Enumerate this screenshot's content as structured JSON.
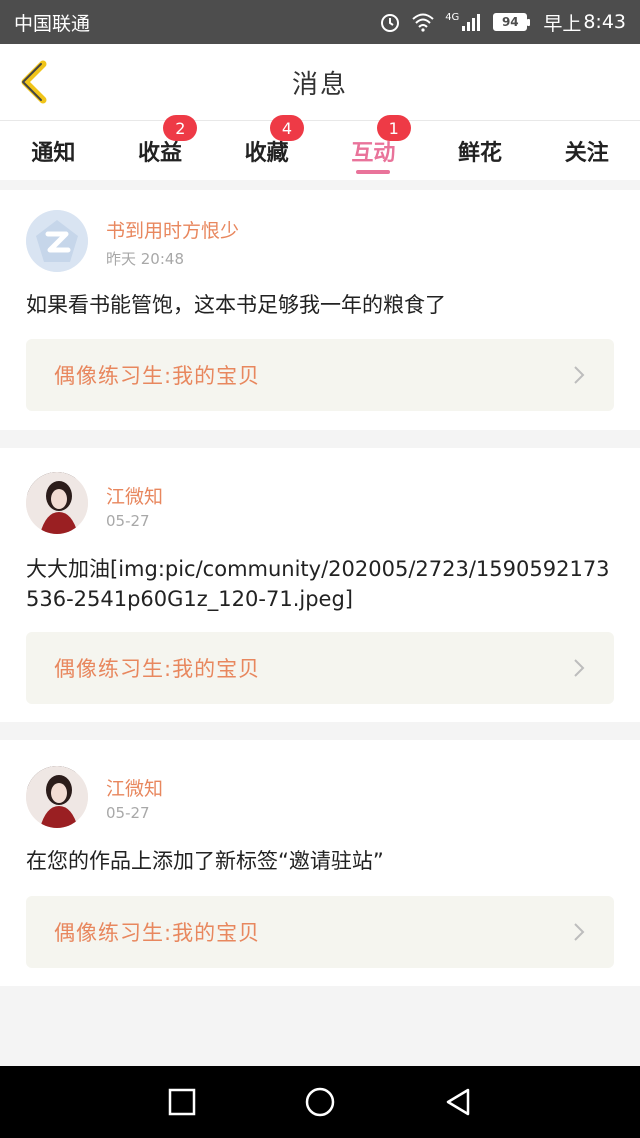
{
  "status_bar": {
    "carrier": "中国联通",
    "network": "4G",
    "battery": "94",
    "clock_prefix": "早上",
    "time": "8:43"
  },
  "header": {
    "title": "消息"
  },
  "tabs": [
    {
      "label": "通知",
      "badge": null,
      "active": false
    },
    {
      "label": "收益",
      "badge": "2",
      "active": false
    },
    {
      "label": "收藏",
      "badge": "4",
      "active": false
    },
    {
      "label": "互动",
      "badge": "1",
      "active": true
    },
    {
      "label": "鲜花",
      "badge": null,
      "active": false
    },
    {
      "label": "关注",
      "badge": null,
      "active": false
    }
  ],
  "messages": [
    {
      "user": "书到用时方恨少",
      "time": "昨天 20:48",
      "avatar": "qq-default-avatar",
      "content": "如果看书能管饱，这本书足够我一年的粮食了",
      "link": "偶像练习生:我的宝贝"
    },
    {
      "user": "江微知",
      "time": "05-27",
      "avatar": "user-photo-avatar",
      "content": "大大加油[img:pic/community/202005/2723/1590592173536-2541p60G1z_120-71.jpeg]",
      "link": "偶像练习生:我的宝贝"
    },
    {
      "user": "江微知",
      "time": "05-27",
      "avatar": "user-photo-avatar",
      "content": "在您的作品上添加了新标签“邀请驻站”",
      "link": "偶像练习生:我的宝贝"
    }
  ],
  "colors": {
    "accent": "#e9739a",
    "username": "#e8875e",
    "badge": "#ee3a46",
    "back_arrow": "#f0c419"
  }
}
